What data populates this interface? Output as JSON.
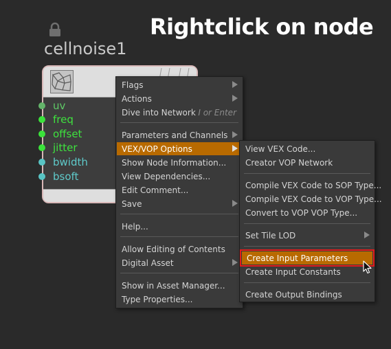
{
  "headline": "Rightclick on node",
  "node": {
    "title": "cellnoise1",
    "ports": [
      {
        "label": "uv",
        "color": "#64b46a"
      },
      {
        "label": "freq",
        "color": "#3be23b"
      },
      {
        "label": "offset",
        "color": "#3be23b"
      },
      {
        "label": "jitter",
        "color": "#3be23b"
      },
      {
        "label": "bwidth",
        "color": "#59c4c4"
      },
      {
        "label": "bsoft",
        "color": "#59c4c4"
      }
    ]
  },
  "context_menu": {
    "items": {
      "flags": "Flags",
      "actions": "Actions",
      "dive": "Dive into Network",
      "dive_shortcut": "I or Enter",
      "parameters_channels": "Parameters and Channels",
      "vex_vop_options": "VEX/VOP Options",
      "show_node_info": "Show Node Information...",
      "view_dependencies": "View Dependencies...",
      "edit_comment": "Edit Comment...",
      "save": "Save",
      "help": "Help...",
      "allow_editing": "Allow Editing of Contents",
      "digital_asset": "Digital Asset",
      "show_asset_manager": "Show in Asset Manager...",
      "type_properties": "Type Properties..."
    }
  },
  "submenu": {
    "items": {
      "view_vex_code": "View VEX Code...",
      "creator_vop_network": "Creator VOP Network",
      "compile_sop": "Compile VEX Code to SOP Type...",
      "compile_vop": "Compile VEX Code to VOP Type...",
      "convert_vop": "Convert to VOP VOP Type...",
      "set_tile_lod": "Set Tile LOD",
      "create_input_parameters": "Create Input Parameters",
      "create_input_constants": "Create Input Constants",
      "create_output_bindings": "Create Output Bindings"
    }
  },
  "colors": {
    "background": "#2a2a2a",
    "menu_highlight": "#b86a00",
    "callout_outline": "#e51b1b"
  },
  "icons": [
    "lock-icon",
    "cellnoise-thumbnail-icon",
    "submenu-arrow-icon",
    "mouse-cursor-icon"
  ]
}
